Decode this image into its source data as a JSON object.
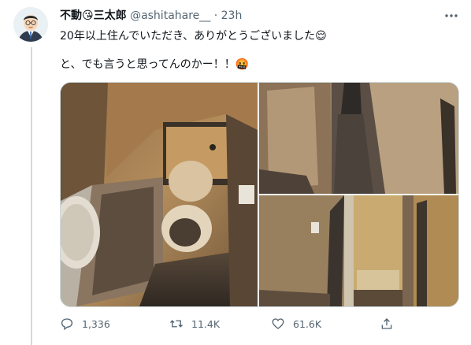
{
  "tweet": {
    "author": {
      "name": "不動",
      "name_suffix": "三太郎",
      "handle": "@ashitahare__",
      "separator": "·",
      "time": "23h"
    },
    "lines": [
      "20年以上住んでいただき、ありがとうございました",
      "と、でも言うと思ってんのかー！！"
    ],
    "emoji_1": "😌",
    "emoji_2": "🤬",
    "name_emoji": "😘",
    "icons": {
      "more": "more-icon",
      "reply": "reply-icon",
      "retweet": "retweet-icon",
      "like": "like-icon",
      "share": "share-icon"
    },
    "actions": {
      "replies": "1,336",
      "retweets": "11.4K",
      "likes": "61.6K"
    },
    "photos": [
      "photo-toilet",
      "photo-hallway",
      "photo-bathroom-doorway"
    ]
  },
  "colors": {
    "text": "#0f1419",
    "muted": "#536471",
    "border": "#cfd9de",
    "background": "#ffffff"
  }
}
